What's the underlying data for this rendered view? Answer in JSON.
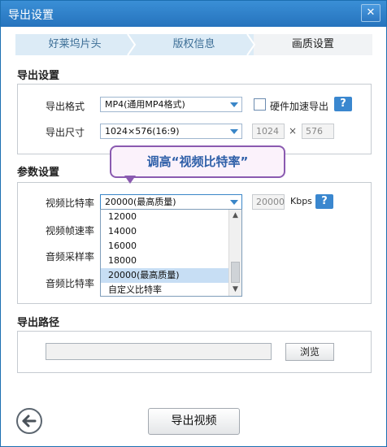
{
  "window": {
    "title": "导出设置",
    "close_label": "✕"
  },
  "steps": [
    {
      "label": "好莱坞片头",
      "active": false
    },
    {
      "label": "版权信息",
      "active": false
    },
    {
      "label": "画质设置",
      "active": true
    }
  ],
  "export_settings": {
    "section_title": "导出设置",
    "format_label": "导出格式",
    "format_value": "MP4(通用MP4格式)",
    "hw_accel_label": "硬件加速导出",
    "hw_accel_checked": false,
    "size_label": "导出尺寸",
    "size_value": "1024×576(16:9)",
    "width_value": "1024",
    "times_symbol": "×",
    "height_value": "576"
  },
  "tooltip": {
    "text": "调高“视频比特率”"
  },
  "params": {
    "section_title": "参数设置",
    "video_bitrate_label": "视频比特率",
    "video_bitrate_value": "20000(最高质量)",
    "bitrate_custom_value": "20000",
    "bitrate_unit": "Kbps",
    "frame_rate_label": "视频帧速率",
    "audio_sample_label": "音频采样率",
    "audio_bitrate_label": "音频比特率",
    "dropdown_options": [
      "12000",
      "14000",
      "16000",
      "18000",
      "20000(最高质量)",
      "自定义比特率"
    ],
    "dropdown_selected": "20000(最高质量)"
  },
  "export_path": {
    "section_title": "导出路径",
    "path_value": "",
    "browse_label": "浏览"
  },
  "footer": {
    "export_label": "导出视频"
  },
  "help_label": "?",
  "colors": {
    "title_bar": "#2a7cc6",
    "accent": "#3a87cf",
    "tooltip_border": "#8a5ab0",
    "tooltip_text": "#2e5fa8"
  }
}
